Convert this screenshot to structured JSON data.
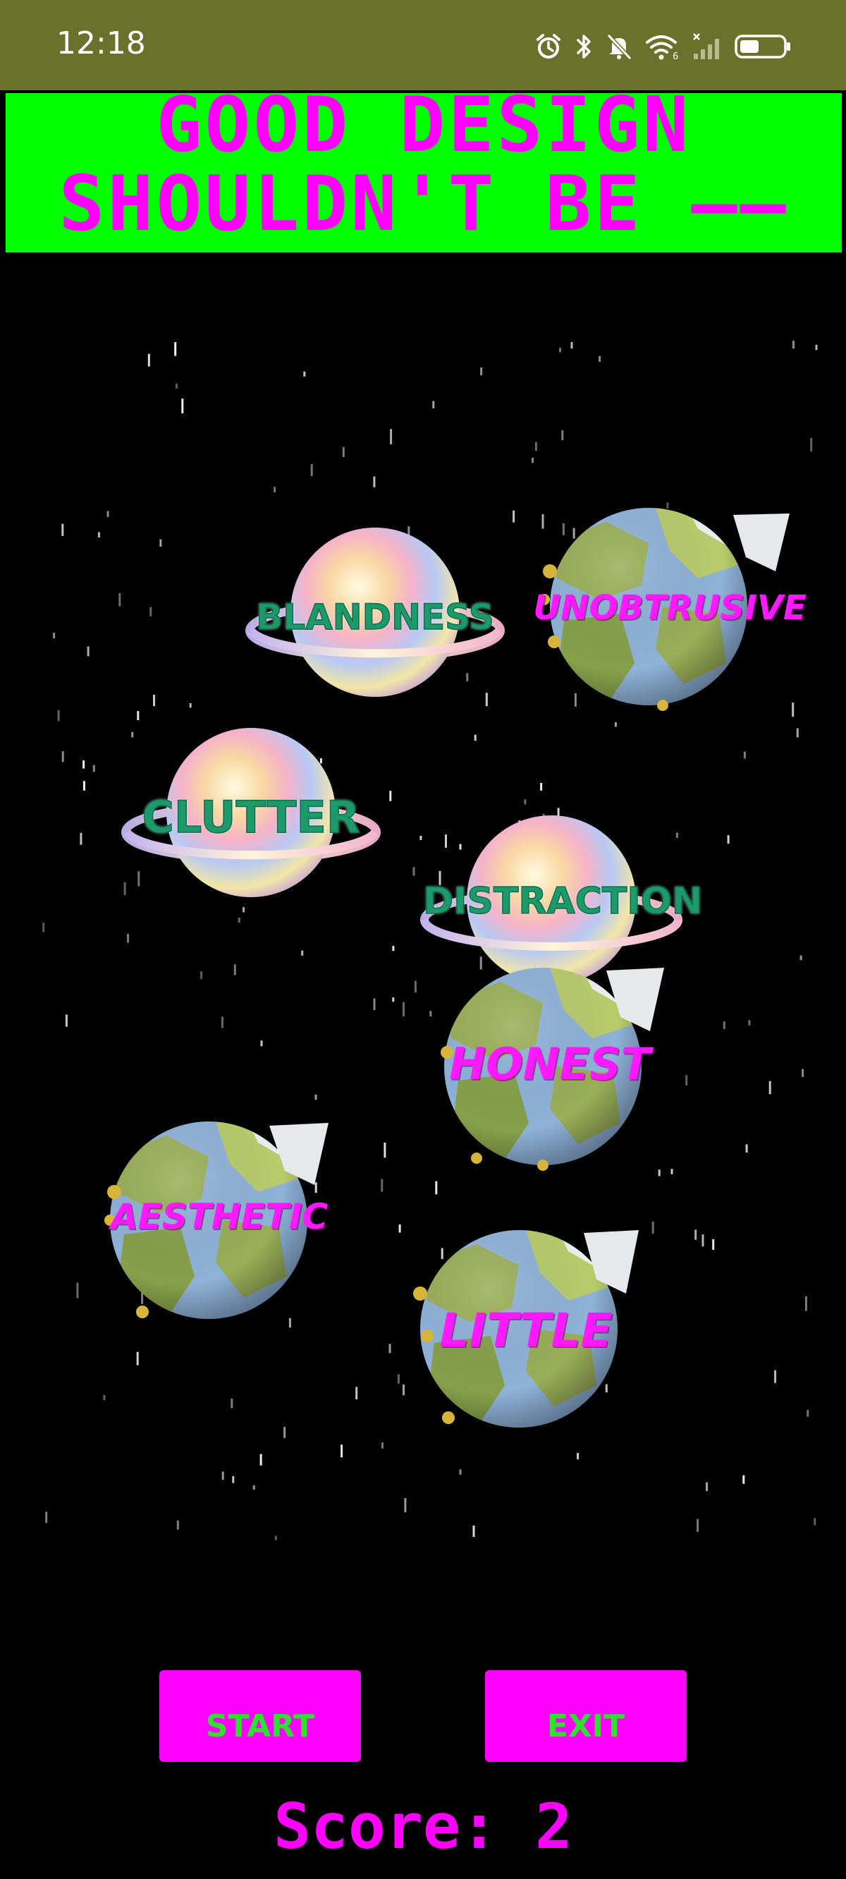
{
  "status_bar": {
    "time": "12:18",
    "icons": [
      "alarm-icon",
      "bluetooth-icon",
      "mute-icon",
      "wifi-icon",
      "signal-icon",
      "battery-icon"
    ]
  },
  "header": {
    "line1": "GOOD DESIGN",
    "line2": "SHOULDN'T BE ——",
    "background_color": "#00ff00",
    "text_color": "#ff00ff"
  },
  "planets": [
    {
      "word": "BLANDNESS",
      "kind": "ringed-moon"
    },
    {
      "word": "UNOBTRUSIVE",
      "kind": "earth"
    },
    {
      "word": "CLUTTER",
      "kind": "ringed-moon"
    },
    {
      "word": "DISTRACTION",
      "kind": "ringed-moon"
    },
    {
      "word": "HONEST",
      "kind": "earth"
    },
    {
      "word": "AESTHETIC",
      "kind": "earth"
    },
    {
      "word": "LITTLE",
      "kind": "earth"
    }
  ],
  "controls": {
    "start_label": "START",
    "exit_label": "EXIT",
    "button_color": "#ff00ff",
    "button_text_color": "#2fe02f"
  },
  "score": {
    "label": "Score:",
    "value": 2
  }
}
